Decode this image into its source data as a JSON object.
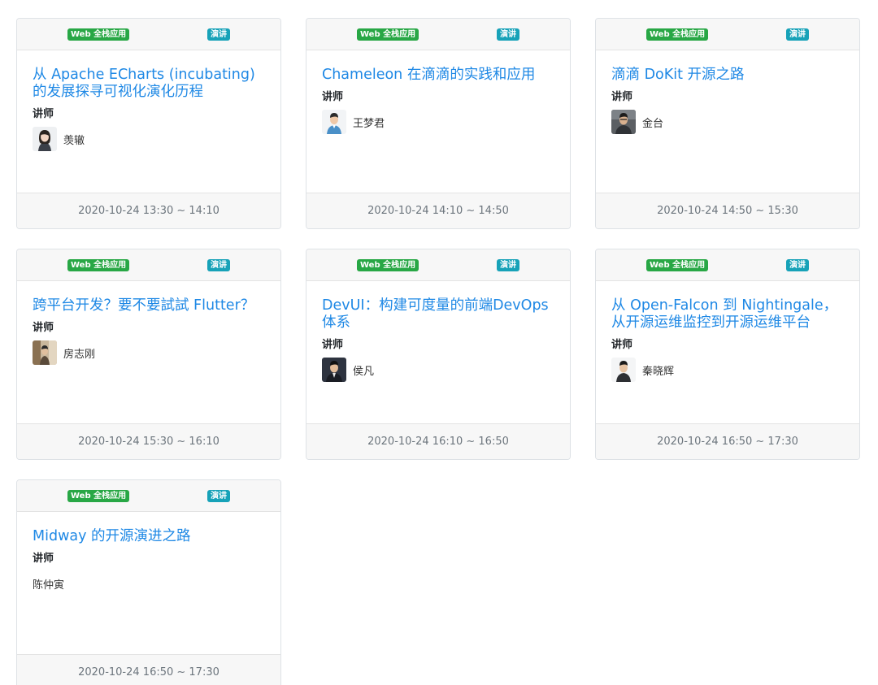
{
  "cards": [
    {
      "track": "Web 全栈应用",
      "type": "演讲",
      "title": "从 Apache ECharts (incubating) 的发展探寻可视化演化历程",
      "speaker_label": "讲师",
      "speaker": "羡辙",
      "avatar_icon": "female-speaker-avatar",
      "time": "2020-10-24 13:30 ~ 14:10"
    },
    {
      "track": "Web 全栈应用",
      "type": "演讲",
      "title": "Chameleon 在滴滴的实践和应用",
      "speaker_label": "讲师",
      "speaker": "王梦君",
      "avatar_icon": "male-speaker-avatar",
      "time": "2020-10-24 14:10 ~ 14:50"
    },
    {
      "track": "Web 全栈应用",
      "type": "演讲",
      "title": "滴滴 DoKit 开源之路",
      "speaker_label": "讲师",
      "speaker": "金台",
      "avatar_icon": "male-speaker-avatar",
      "time": "2020-10-24 14:50 ~ 15:30"
    },
    {
      "track": "Web 全栈应用",
      "type": "演讲",
      "title": "跨平台开发？要不要試試 Flutter？",
      "speaker_label": "讲师",
      "speaker": "房志刚",
      "avatar_icon": "speaker-photo-avatar",
      "time": "2020-10-24 15:30 ~ 16:10"
    },
    {
      "track": "Web 全栈应用",
      "type": "演讲",
      "title": "DevUI：构建可度量的前端DevOps 体系",
      "speaker_label": "讲师",
      "speaker": "侯凡",
      "avatar_icon": "male-speaker-avatar",
      "time": "2020-10-24 16:10 ~ 16:50"
    },
    {
      "track": "Web 全栈应用",
      "type": "演讲",
      "title": "从 Open-Falcon 到 Nightingale，从开源运维监控到开源运维平台",
      "speaker_label": "讲师",
      "speaker": "秦晓辉",
      "avatar_icon": "male-speaker-avatar",
      "time": "2020-10-24 16:50 ~ 17:30"
    },
    {
      "track": "Web 全栈应用",
      "type": "演讲",
      "title": "Midway 的开源演进之路",
      "speaker_label": "讲师",
      "speaker": "陈仲寅",
      "avatar_icon": "",
      "time": "2020-10-24 16:50 ~ 17:30"
    }
  ],
  "colors": {
    "track_badge": "#28a745",
    "type_badge": "#17a2b8",
    "title_link": "#1e88e5"
  }
}
